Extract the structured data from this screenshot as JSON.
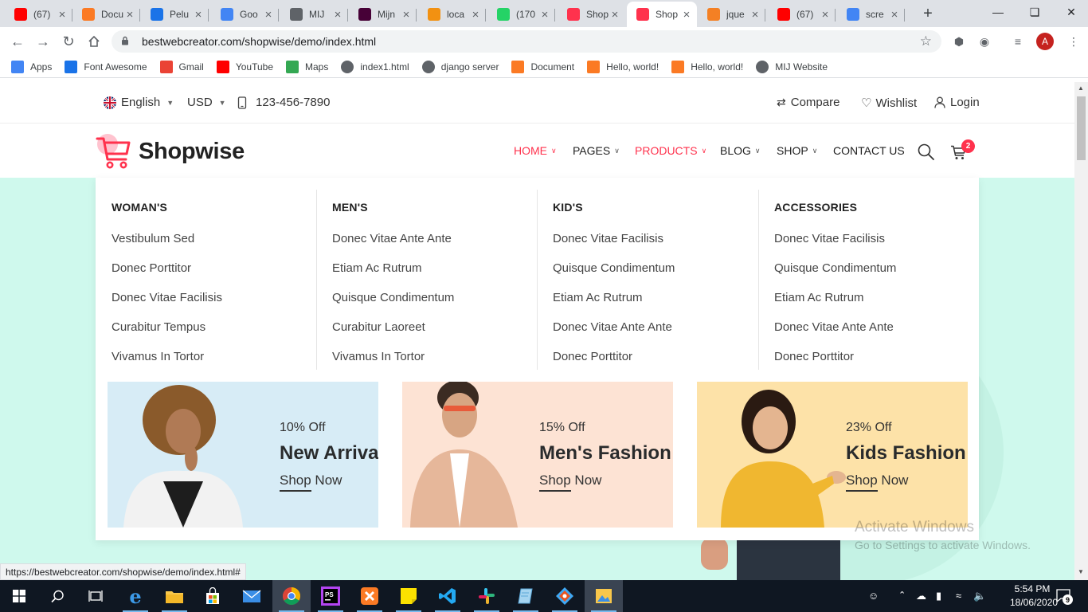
{
  "browser": {
    "tabs": [
      {
        "title": "(67)",
        "favicon": "youtube-icon",
        "color": "#ff0000"
      },
      {
        "title": "Docu",
        "favicon": "xampp-icon",
        "color": "#fb7a24"
      },
      {
        "title": "Pelu",
        "favicon": "shield-icon",
        "color": "#1a73e8"
      },
      {
        "title": "Goo",
        "favicon": "google-icon",
        "color": "#4285f4"
      },
      {
        "title": "MIJ",
        "favicon": "globe-icon",
        "color": "#5f6368"
      },
      {
        "title": "Mijn",
        "favicon": "xd-icon",
        "color": "#470137"
      },
      {
        "title": "loca",
        "favicon": "phpmyadmin-icon",
        "color": "#f29111"
      },
      {
        "title": "(170",
        "favicon": "whatsapp-icon",
        "color": "#25d366"
      },
      {
        "title": "Shop",
        "favicon": "cart-icon",
        "color": "#ff324d"
      },
      {
        "title": "Shop",
        "favicon": "cart-icon",
        "color": "#ff324d"
      },
      {
        "title": "jque",
        "favicon": "stackoverflow-icon",
        "color": "#f48024"
      },
      {
        "title": "(67)",
        "favicon": "youtube-icon",
        "color": "#ff0000"
      },
      {
        "title": "scre",
        "favicon": "google-icon",
        "color": "#4285f4"
      }
    ],
    "active_tab_index": 9,
    "url": "bestwebcreator.com/shopwise/demo/index.html",
    "profile_initial": "A",
    "ext_badge_1": "1",
    "ext_badge_2": "0",
    "bookmarks": [
      {
        "label": "Apps",
        "icon": "apps-grid-icon"
      },
      {
        "label": "Font Awesome",
        "icon": "flag-icon"
      },
      {
        "label": "Gmail",
        "icon": "gmail-icon"
      },
      {
        "label": "YouTube",
        "icon": "youtube-icon"
      },
      {
        "label": "Maps",
        "icon": "maps-pin-icon"
      },
      {
        "label": "index1.html",
        "icon": "globe-icon"
      },
      {
        "label": "django server",
        "icon": "globe-icon"
      },
      {
        "label": "Document",
        "icon": "xampp-icon"
      },
      {
        "label": "Hello, world!",
        "icon": "xampp-icon"
      },
      {
        "label": "Hello, world!",
        "icon": "xampp-icon"
      },
      {
        "label": "MIJ Website",
        "icon": "globe-icon"
      }
    ],
    "status_url": "https://bestwebcreator.com/shopwise/demo/index.html#"
  },
  "topbar": {
    "language": "English",
    "currency": "USD",
    "phone": "123-456-7890",
    "compare": "Compare",
    "wishlist": "Wishlist",
    "login": "Login"
  },
  "nav": {
    "brand": "Shopwise",
    "items": [
      "HOME",
      "PAGES",
      "PRODUCTS",
      "BLOG",
      "SHOP",
      "CONTACT US"
    ],
    "cart_count": "2",
    "accent": "#ff324d"
  },
  "mega_menu": {
    "columns": [
      {
        "heading": "WOMAN'S",
        "items": [
          "Vestibulum Sed",
          "Donec Porttitor",
          "Donec Vitae Facilisis",
          "Curabitur Tempus",
          "Vivamus In Tortor"
        ]
      },
      {
        "heading": "MEN'S",
        "items": [
          "Donec Vitae Ante Ante",
          "Etiam Ac Rutrum",
          "Quisque Condimentum",
          "Curabitur Laoreet",
          "Vivamus In Tortor"
        ]
      },
      {
        "heading": "KID'S",
        "items": [
          "Donec Vitae Facilisis",
          "Quisque Condimentum",
          "Etiam Ac Rutrum",
          "Donec Vitae Ante Ante",
          "Donec Porttitor"
        ]
      },
      {
        "heading": "ACCESSORIES",
        "items": [
          "Donec Vitae Facilisis",
          "Quisque Condimentum",
          "Etiam Ac Rutrum",
          "Donec Vitae Ante Ante",
          "Donec Porttitor"
        ]
      }
    ],
    "banners": [
      {
        "discount": "10% Off",
        "title": "New Arrival",
        "cta": "Shop Now",
        "bg": "#d7ecf6"
      },
      {
        "discount": "15% Off",
        "title": "Men's Fashion",
        "cta": "Shop Now",
        "bg": "#fde3d4"
      },
      {
        "discount": "23% Off",
        "title": "Kids Fashion",
        "cta": "Shop Now",
        "bg": "#fde2a8"
      }
    ]
  },
  "watermark": {
    "line1": "Activate Windows",
    "line2": "Go to Settings to activate Windows."
  },
  "taskbar": {
    "time": "5:54 PM",
    "date": "18/06/2020",
    "notifications": "9"
  }
}
